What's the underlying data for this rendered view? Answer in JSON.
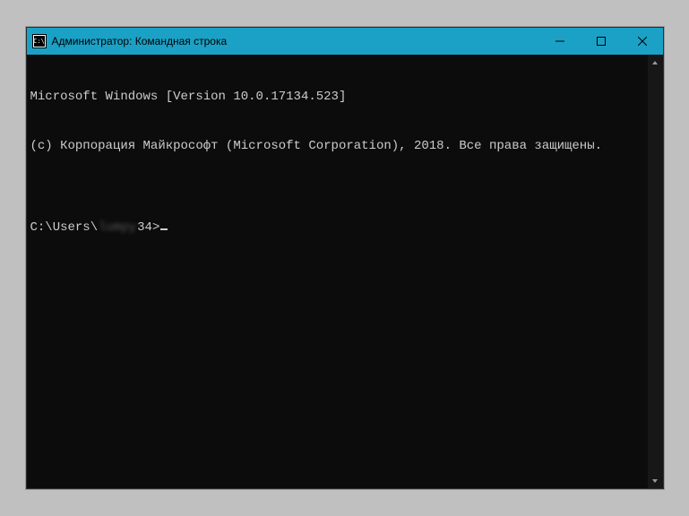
{
  "window": {
    "title": "Администратор: Командная строка"
  },
  "terminal": {
    "line1": "Microsoft Windows [Version 10.0.17134.523]",
    "line2": "(c) Корпорация Майкрософт (Microsoft Corporation), 2018. Все права защищены.",
    "blank": "",
    "prompt_prefix": "C:\\Users\\",
    "prompt_user_hidden": "lumpy",
    "prompt_suffix": "34>"
  }
}
